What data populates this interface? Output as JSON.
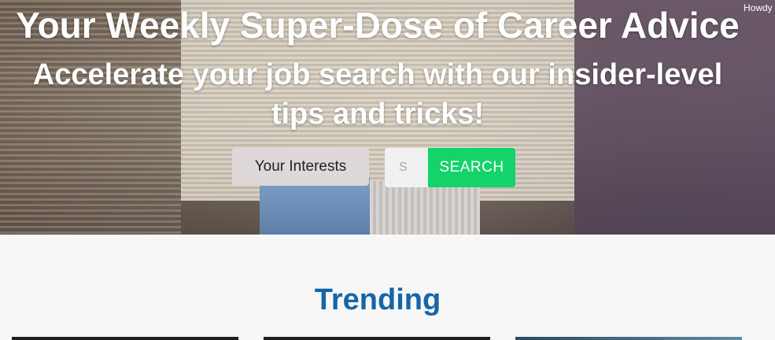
{
  "header": {
    "greeting": "Howdy"
  },
  "hero": {
    "title": "Your Weekly Super-Dose of Career Advice",
    "subtitle_line1": "Accelerate your job search with our insider-level",
    "subtitle_line2": "tips and tricks!"
  },
  "filters": {
    "interests_label": "Your Interests",
    "search_placeholder": "S",
    "search_button_label": "SEARCH"
  },
  "trending": {
    "heading": "Trending"
  },
  "colors": {
    "accent_green": "#14d36a",
    "heading_blue": "#1565a8"
  }
}
